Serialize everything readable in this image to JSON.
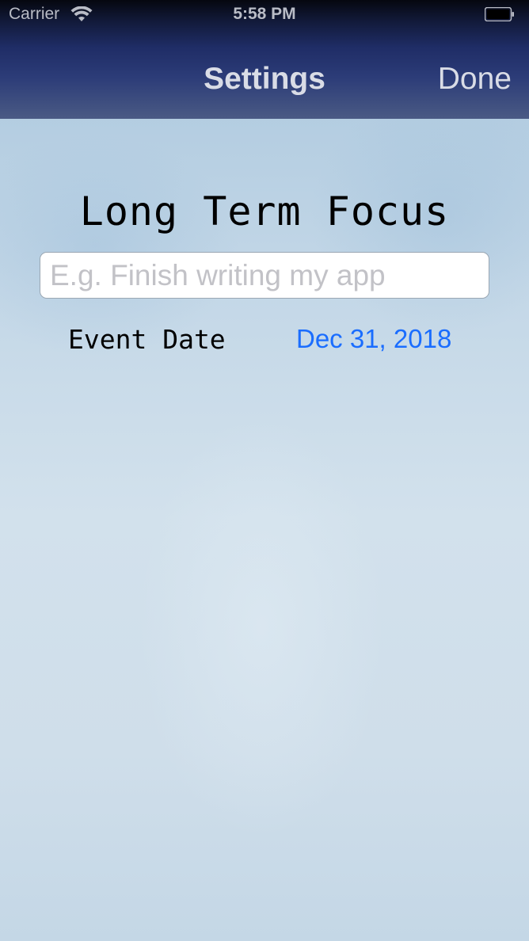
{
  "status_bar": {
    "carrier": "Carrier",
    "time": "5:58 PM",
    "icons": [
      "wifi-icon",
      "battery-icon"
    ]
  },
  "nav": {
    "title": "Settings",
    "done_label": "Done"
  },
  "focus": {
    "title": "Long Term Focus",
    "input_value": "",
    "placeholder": "E.g. Finish writing my app"
  },
  "event": {
    "label": "Event Date",
    "date": "Dec 31, 2018"
  },
  "colors": {
    "header": "#1f2d66",
    "date_link": "#1a6dff",
    "placeholder": "#c2c2c7",
    "background": "#c8dbe9"
  }
}
